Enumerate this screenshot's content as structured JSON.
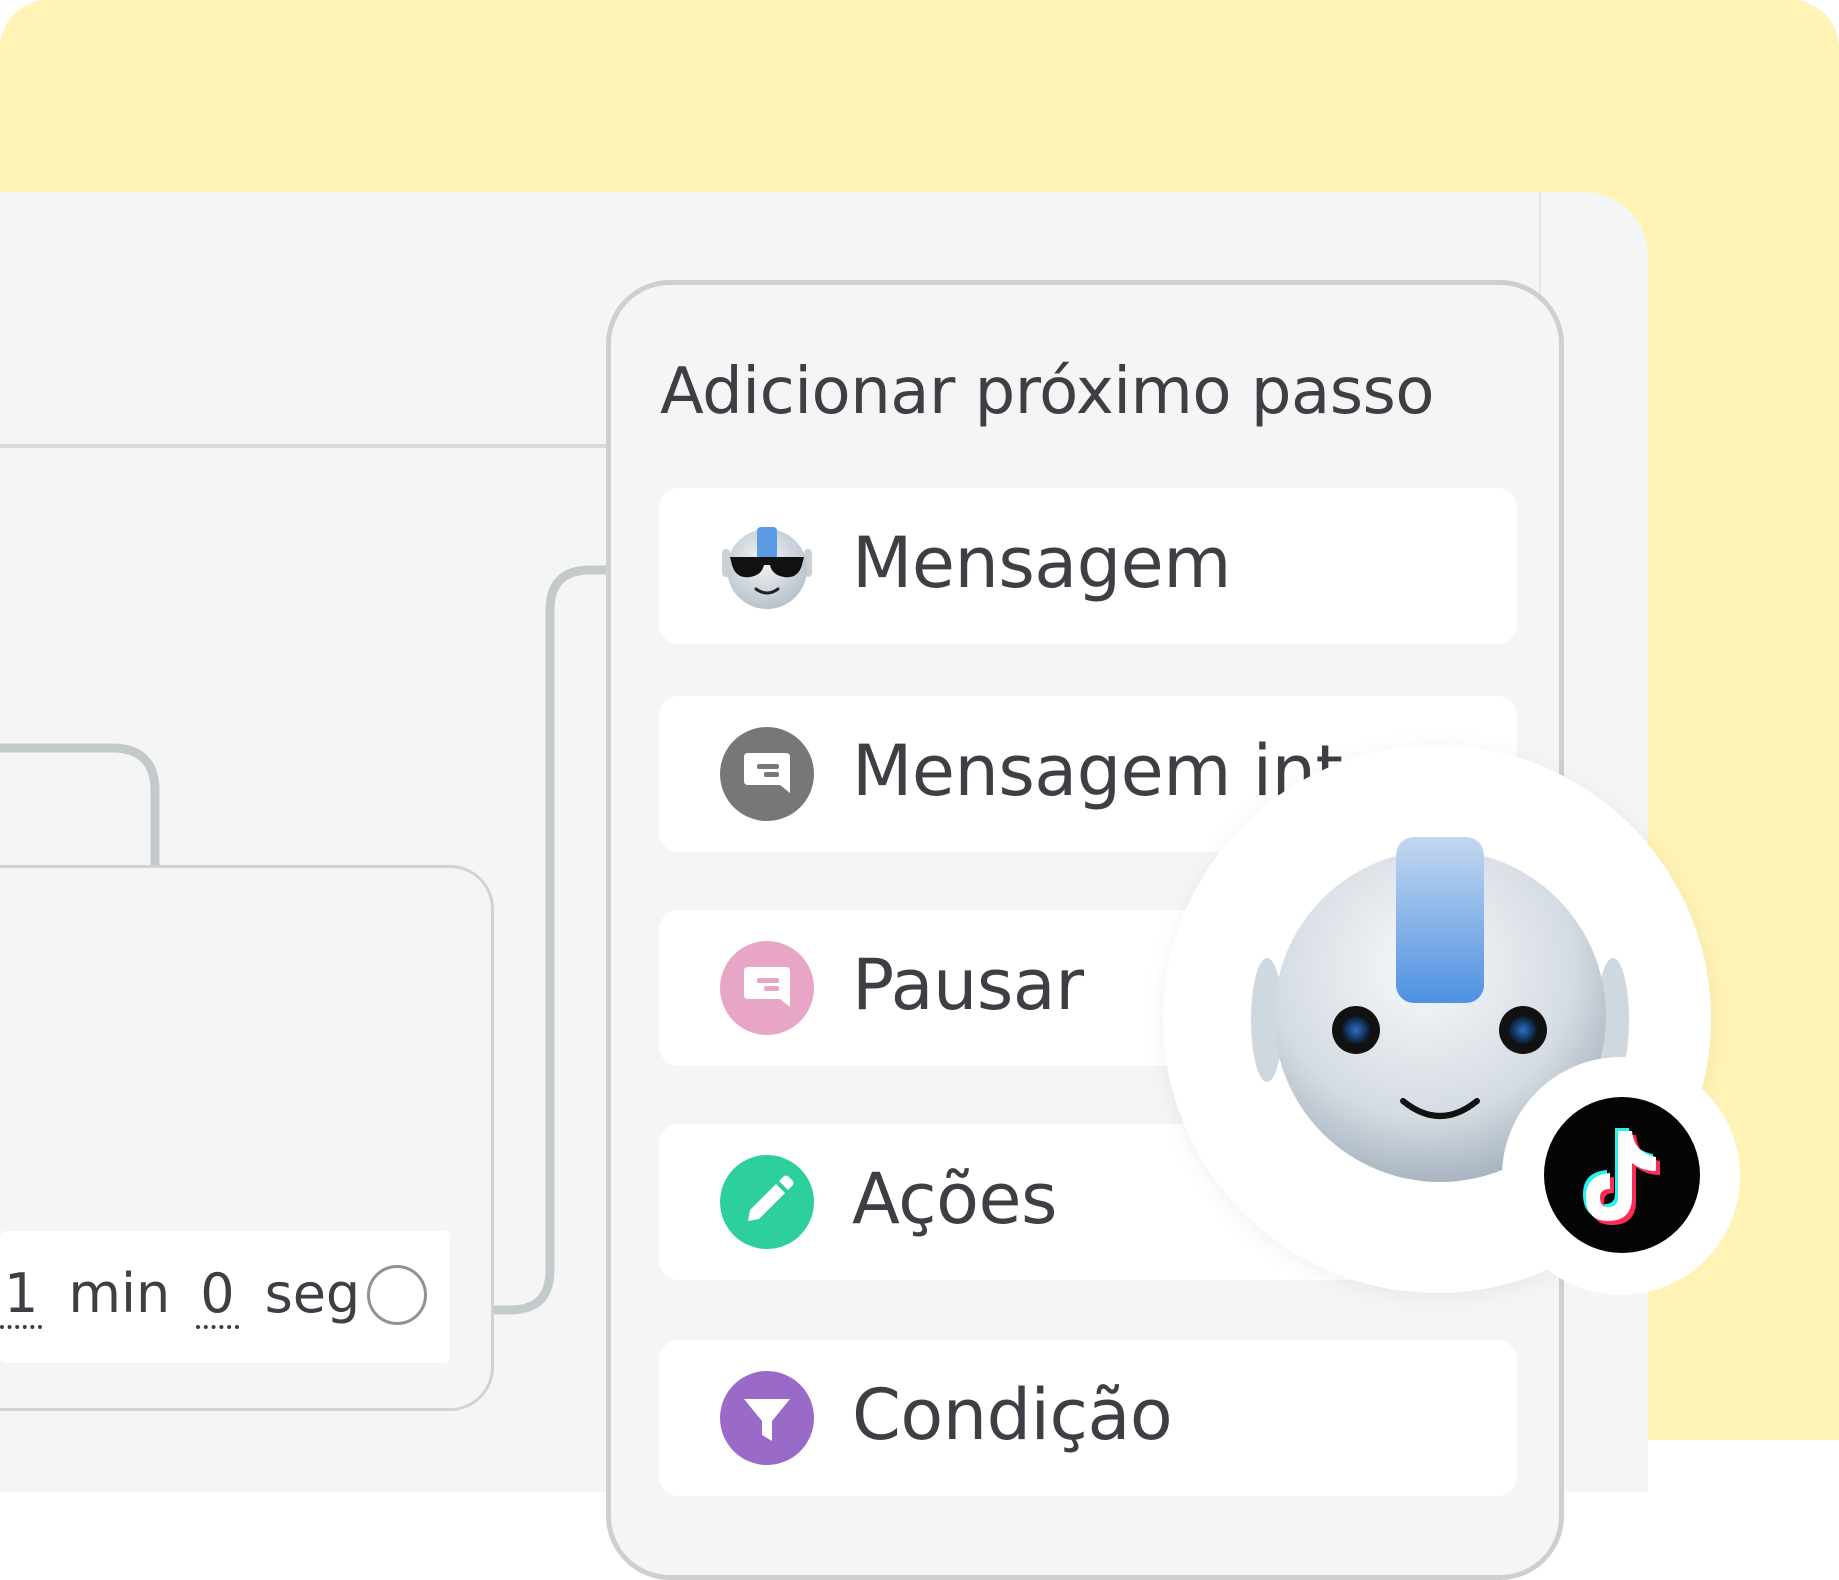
{
  "panel": {
    "title": "Adicionar próximo passo",
    "steps": [
      {
        "label": "Mensagem",
        "icon": "robot-sunglasses-icon"
      },
      {
        "label": "Mensagem int",
        "icon": "chat-bubble-icon",
        "icon_color": "#777777"
      },
      {
        "label": "Pausar",
        "icon": "chat-bubble-icon",
        "icon_color": "#e8a6c6"
      },
      {
        "label": "Ações",
        "icon": "pencil-icon",
        "icon_color": "#2ecf9f"
      },
      {
        "label": "Condição",
        "icon": "filter-icon",
        "icon_color": "#9a6ac8"
      }
    ]
  },
  "timer": {
    "minutes": "1",
    "minutes_unit": "min",
    "seconds": "0",
    "seconds_unit": "seg"
  },
  "badges": {
    "bot_avatar": "robot-avatar-icon",
    "channel": "tiktok-icon"
  },
  "colors": {
    "background_yellow": "#fff3b5",
    "canvas": "#f5f5f6",
    "connector": "#c4cacc",
    "text": "#3d3f44"
  }
}
